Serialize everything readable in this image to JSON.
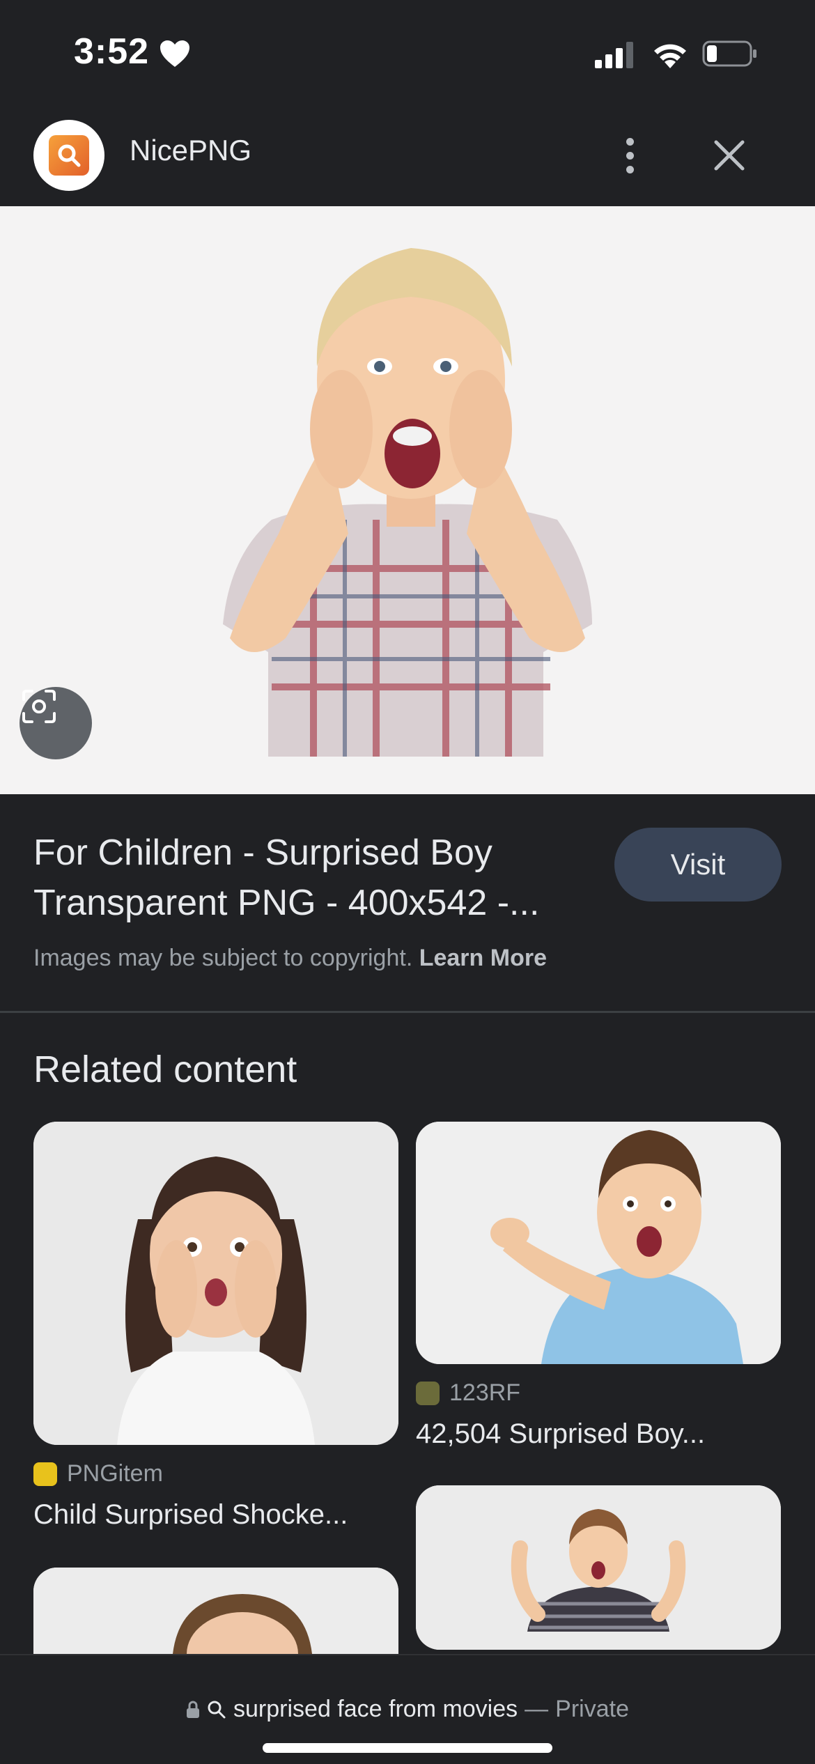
{
  "status_bar": {
    "time": "3:52"
  },
  "header": {
    "site_name": "NicePNG"
  },
  "result": {
    "title_line1": "For Children - Surprised Boy",
    "title_line2": "Transparent PNG - 400x542 -...",
    "visit_label": "Visit",
    "copyright_text": "Images may be subject to copyright.",
    "learn_more": "Learn More"
  },
  "related": {
    "heading": "Related content",
    "items": [
      {
        "source": "PNGitem",
        "caption": "Child Surprised Shocke..."
      },
      {
        "source": "123RF",
        "caption": "42,504 Surprised Boy..."
      }
    ]
  },
  "bottom_bar": {
    "query": "surprised face from movies",
    "separator": "—",
    "mode": "Private"
  },
  "colors": {
    "background": "#202124",
    "visit_button": "#394457",
    "logo_orange": "#e2602a"
  },
  "icons": [
    "heart-icon",
    "signal-icon",
    "wifi-icon",
    "battery-icon",
    "more-vert-icon",
    "close-icon",
    "lens-icon",
    "lock-icon",
    "search-icon"
  ]
}
